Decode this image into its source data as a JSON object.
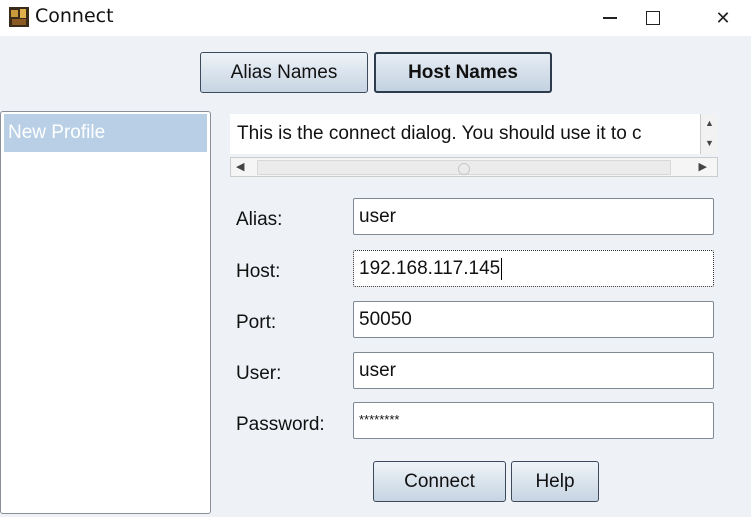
{
  "window": {
    "title": "Connect",
    "icon": "app-icon",
    "controls": {
      "minimize": "minimize-icon",
      "maximize": "maximize-icon",
      "close": "close-icon",
      "close_glyph": "✕"
    }
  },
  "tabs": {
    "alias_label": "Alias Names",
    "host_label": "Host Names",
    "selected": "Host Names"
  },
  "profiles": {
    "items": [
      "New Profile"
    ],
    "selected": "New Profile"
  },
  "info": {
    "text": "This is the connect dialog. You should use it to c",
    "scroll_up": "▲",
    "scroll_down": "▼",
    "scroll_left": "◀",
    "scroll_right": "▶"
  },
  "form": {
    "alias": {
      "label": "Alias:",
      "value": "user"
    },
    "host": {
      "label": "Host:",
      "value": "192.168.117.145"
    },
    "port": {
      "label": "Port:",
      "value": "50050"
    },
    "user": {
      "label": "User:",
      "value": "user"
    },
    "password": {
      "label": "Password:",
      "value": "********"
    }
  },
  "buttons": {
    "connect": "Connect",
    "help": "Help"
  },
  "colors": {
    "background": "#eef2f7",
    "selection": "#b8cfe5",
    "button_top": "#eef3f8",
    "button_bottom": "#c7d4e2"
  }
}
